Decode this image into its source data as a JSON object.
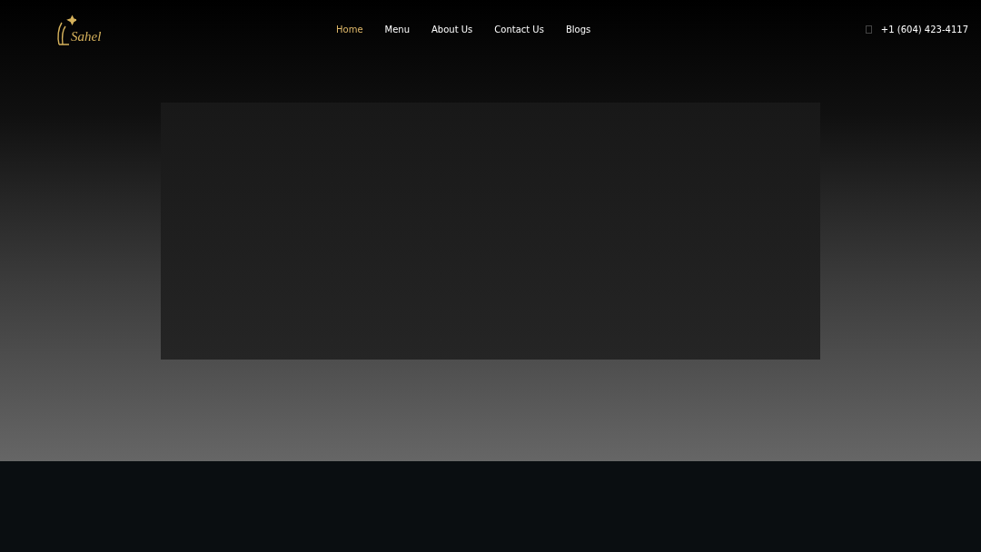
{
  "logo": {
    "text": "Sahel"
  },
  "nav": [
    {
      "label": "Home",
      "selected": true
    },
    {
      "label": "Menu",
      "selected": false
    },
    {
      "label": "About Us",
      "selected": false
    },
    {
      "label": "Contact Us",
      "selected": false
    },
    {
      "label": "Blogs",
      "selected": false
    }
  ],
  "phone": "+1 (604) 423-4117"
}
